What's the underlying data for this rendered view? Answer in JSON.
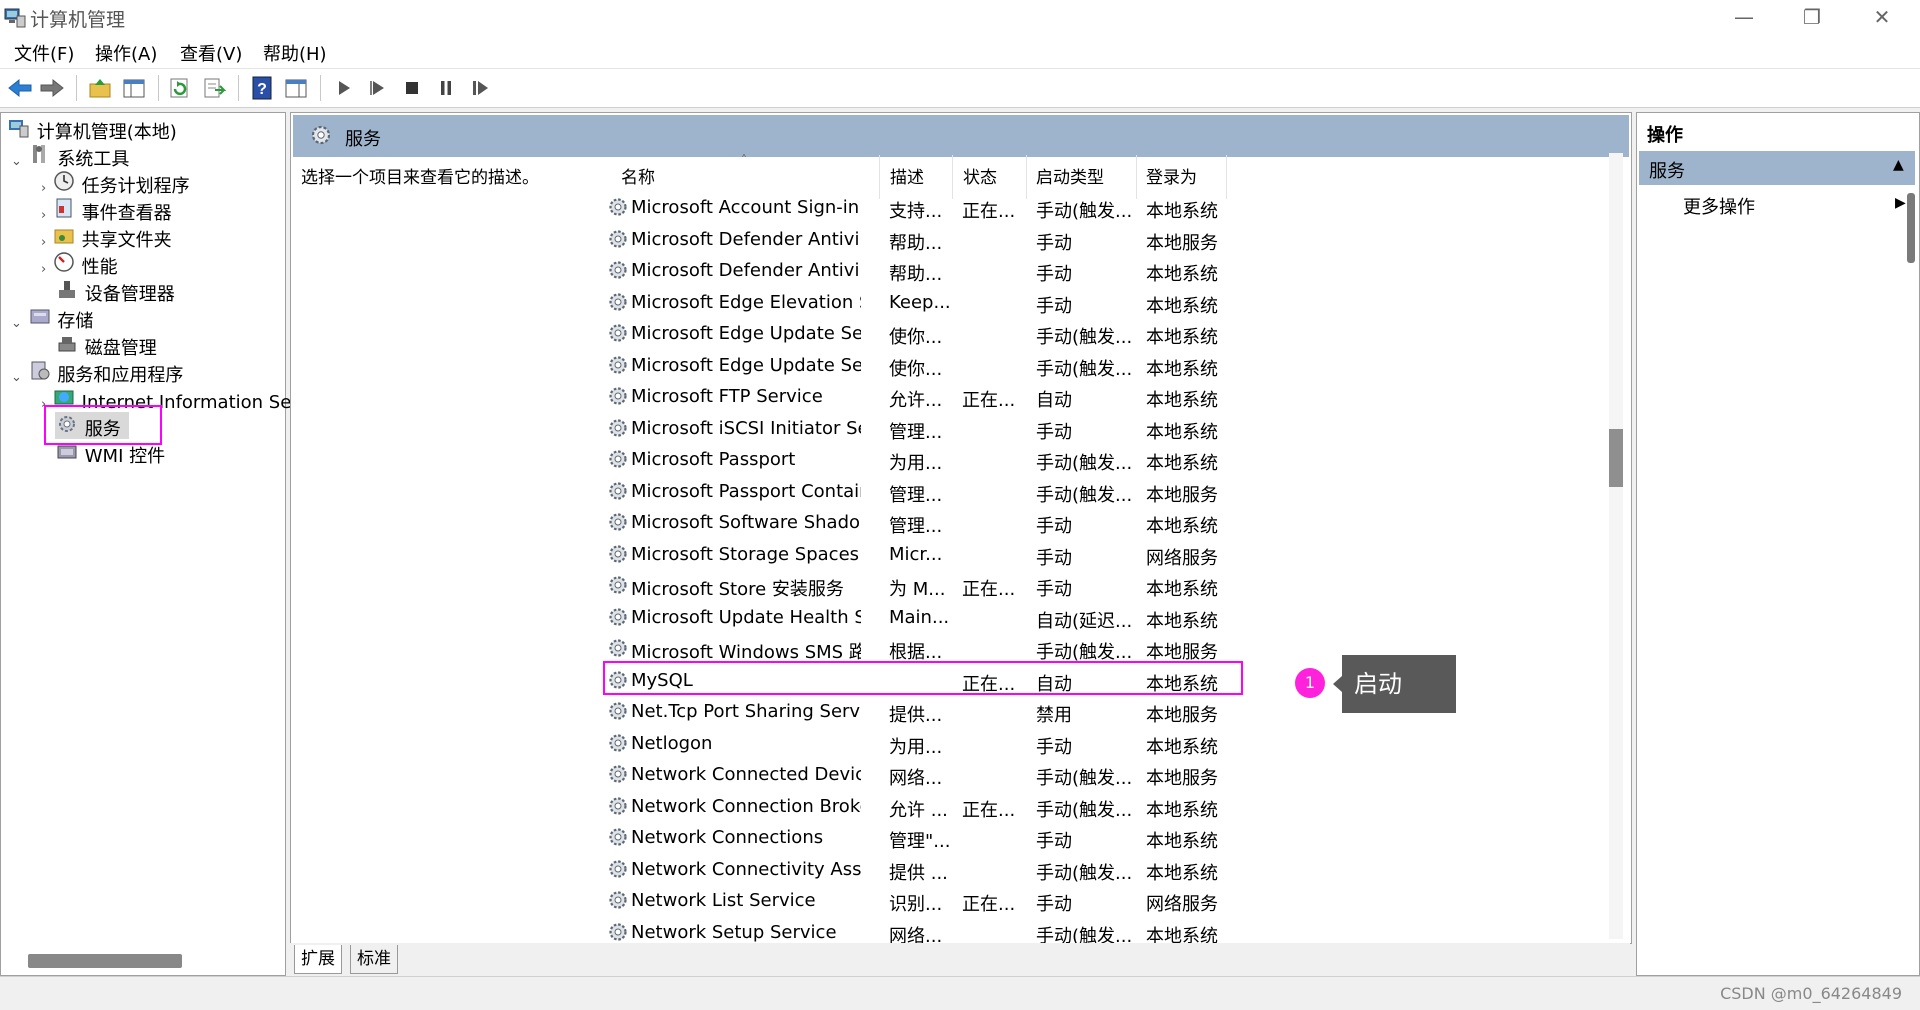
{
  "window": {
    "title": "计算机管理",
    "icon": "computer-management-icon",
    "controls": [
      "minimize-icon",
      "maximize-icon",
      "close-icon"
    ]
  },
  "menu": [
    "文件(F)",
    "操作(A)",
    "查看(V)",
    "帮助(H)"
  ],
  "toolbar": [
    "back-arrow-icon",
    "forward-arrow-icon",
    "up-folder-icon",
    "show-hide-tree-icon",
    "refresh-icon",
    "export-list-icon",
    "help-icon",
    "console-tree-icon",
    "start-service-icon",
    "start-alt-icon",
    "stop-service-icon",
    "pause-service-icon",
    "resume-service-icon"
  ],
  "tree": {
    "root": "计算机管理(本地)",
    "system_tools": "系统工具",
    "task_scheduler": "任务计划程序",
    "event_viewer": "事件查看器",
    "shared_folders": "共享文件夹",
    "performance": "性能",
    "device_manager": "设备管理器",
    "storage": "存储",
    "disk_management": "磁盘管理",
    "services_apps": "服务和应用程序",
    "iis": "Internet Information Se",
    "services": "服务",
    "wmi": "WMI 控件"
  },
  "center": {
    "header": "服务",
    "description": "选择一个项目来查看它的描述。",
    "columns": {
      "name": "名称",
      "desc": "描述",
      "status": "状态",
      "startup": "启动类型",
      "logon": "登录为"
    },
    "rows": [
      {
        "name": "Microsoft Account Sign-in ...",
        "desc": "支持...",
        "status": "正在...",
        "startup": "手动(触发...",
        "logon": "本地系统"
      },
      {
        "name": "Microsoft Defender Antivir...",
        "desc": "帮助...",
        "status": "",
        "startup": "手动",
        "logon": "本地服务"
      },
      {
        "name": "Microsoft Defender Antivir...",
        "desc": "帮助...",
        "status": "",
        "startup": "手动",
        "logon": "本地系统"
      },
      {
        "name": "Microsoft Edge Elevation S...",
        "desc": "Keep...",
        "status": "",
        "startup": "手动",
        "logon": "本地系统"
      },
      {
        "name": "Microsoft Edge Update Ser...",
        "desc": "使你...",
        "status": "",
        "startup": "手动(触发...",
        "logon": "本地系统"
      },
      {
        "name": "Microsoft Edge Update Ser...",
        "desc": "使你...",
        "status": "",
        "startup": "手动(触发...",
        "logon": "本地系统"
      },
      {
        "name": "Microsoft FTP Service",
        "desc": "允许...",
        "status": "正在...",
        "startup": "自动",
        "logon": "本地系统"
      },
      {
        "name": "Microsoft iSCSI Initiator Ser...",
        "desc": "管理...",
        "status": "",
        "startup": "手动",
        "logon": "本地系统"
      },
      {
        "name": "Microsoft Passport",
        "desc": "为用...",
        "status": "",
        "startup": "手动(触发...",
        "logon": "本地系统"
      },
      {
        "name": "Microsoft Passport Container",
        "desc": "管理...",
        "status": "",
        "startup": "手动(触发...",
        "logon": "本地服务"
      },
      {
        "name": "Microsoft Software Shado...",
        "desc": "管理...",
        "status": "",
        "startup": "手动",
        "logon": "本地系统"
      },
      {
        "name": "Microsoft Storage Spaces S...",
        "desc": "Micr...",
        "status": "",
        "startup": "手动",
        "logon": "网络服务"
      },
      {
        "name": "Microsoft Store 安装服务",
        "desc": "为 M...",
        "status": "正在...",
        "startup": "手动",
        "logon": "本地系统"
      },
      {
        "name": "Microsoft Update Health S...",
        "desc": "Main...",
        "status": "",
        "startup": "自动(延迟...",
        "logon": "本地系统"
      },
      {
        "name": "Microsoft Windows SMS 路...",
        "desc": "根据...",
        "status": "",
        "startup": "手动(触发...",
        "logon": "本地服务"
      },
      {
        "name": "MySQL",
        "desc": "",
        "status": "正在...",
        "startup": "自动",
        "logon": "本地系统"
      },
      {
        "name": "Net.Tcp Port Sharing Service",
        "desc": "提供...",
        "status": "",
        "startup": "禁用",
        "logon": "本地服务"
      },
      {
        "name": "Netlogon",
        "desc": "为用...",
        "status": "",
        "startup": "手动",
        "logon": "本地系统"
      },
      {
        "name": "Network Connected Devic...",
        "desc": "网络...",
        "status": "",
        "startup": "手动(触发...",
        "logon": "本地服务"
      },
      {
        "name": "Network Connection Broker",
        "desc": "允许 ...",
        "status": "正在...",
        "startup": "手动(触发...",
        "logon": "本地系统"
      },
      {
        "name": "Network Connections",
        "desc": "管理\"...",
        "status": "",
        "startup": "手动",
        "logon": "本地系统"
      },
      {
        "name": "Network Connectivity Assis...",
        "desc": "提供 ...",
        "status": "",
        "startup": "手动(触发...",
        "logon": "本地系统"
      },
      {
        "name": "Network List Service",
        "desc": "识别...",
        "status": "正在...",
        "startup": "手动",
        "logon": "网络服务"
      },
      {
        "name": "Network Setup Service",
        "desc": "网络...",
        "status": "",
        "startup": "手动(触发...",
        "logon": "本地系统"
      }
    ],
    "tabs": [
      "扩展",
      "标准"
    ]
  },
  "annotation": {
    "step": "1",
    "label": "启动"
  },
  "actions": {
    "title": "操作",
    "section": "服务",
    "more": "更多操作"
  },
  "watermark": "CSDN @m0_64264849",
  "colors": {
    "header_blue": "#9db4cc",
    "highlight_magenta": "#ff00ff",
    "annotation_dot": "#ff22dd",
    "annotation_box": "#595959"
  }
}
